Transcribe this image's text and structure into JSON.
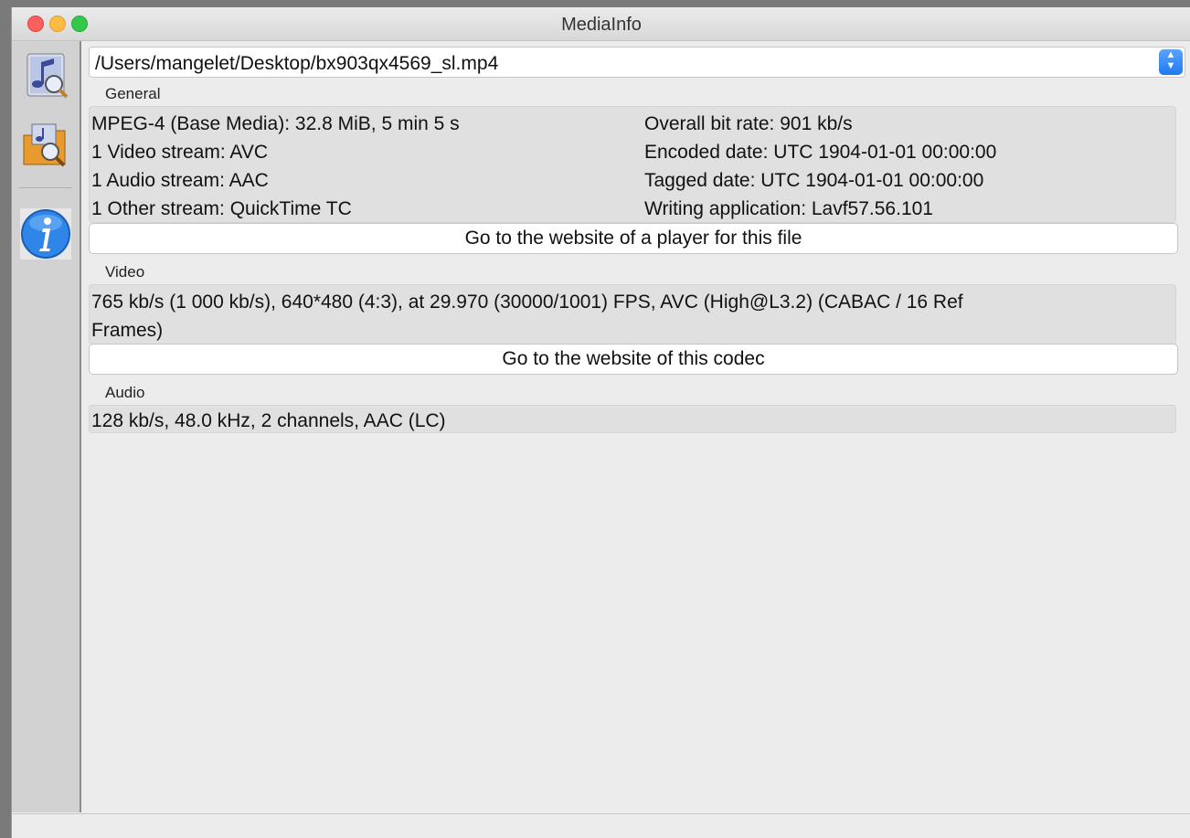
{
  "window": {
    "title": "MediaInfo"
  },
  "sidebar": {
    "icons": [
      "open-file-icon",
      "open-folder-icon",
      "about-info-icon"
    ]
  },
  "file": {
    "path": "/Users/mangelet/Desktop/bx903qx4569_sl.mp4"
  },
  "general": {
    "label": "General",
    "left": [
      "MPEG-4 (Base Media): 32.8 MiB, 5 min 5 s",
      "1 Video stream: AVC",
      "1 Audio stream: AAC",
      "1 Other stream: QuickTime TC"
    ],
    "right": [
      "Overall bit rate: 901 kb/s",
      "Encoded date: UTC 1904-01-01 00:00:00",
      "Tagged date: UTC 1904-01-01 00:00:00",
      "Writing application: Lavf57.56.101"
    ],
    "button_label": "Go to the website of a player for this file"
  },
  "video": {
    "label": "Video",
    "line1": "765 kb/s (1 000 kb/s), 640*480 (4:3), at 29.970 (30000/1001) FPS, AVC (High@L3.2) (CABAC / 16 Ref",
    "line2": "Frames)",
    "button_label": "Go to the website of this codec"
  },
  "audio": {
    "label": "Audio",
    "line1": "128 kb/s, 48.0 kHz, 2 channels, AAC (LC)"
  },
  "colors": {
    "accent": "#1d7bf0",
    "close": "#fc605c",
    "minimize": "#fdbc40",
    "maximize": "#34c84a"
  }
}
